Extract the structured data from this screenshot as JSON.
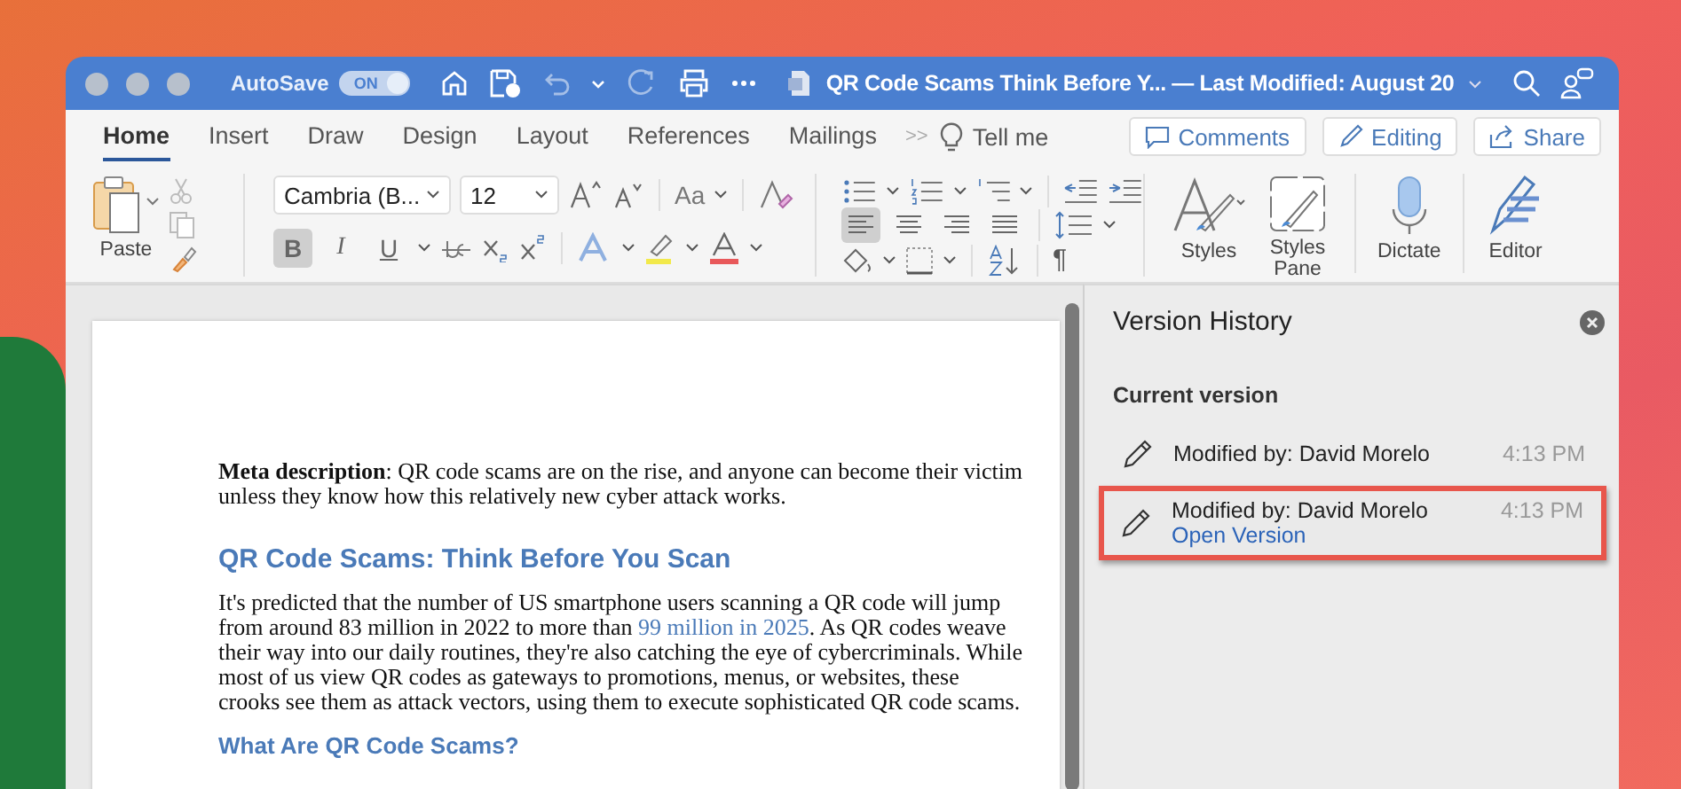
{
  "window": {
    "title": "QR Code Scams Think Before Y... — Last Modified: August 20",
    "autosave": {
      "label": "AutoSave",
      "on": true,
      "toggle_text": "ON"
    }
  },
  "ribbon_tabs": [
    {
      "label": "Home",
      "selected": true
    },
    {
      "label": "Insert",
      "selected": false
    },
    {
      "label": "Draw",
      "selected": false
    },
    {
      "label": "Design",
      "selected": false
    },
    {
      "label": "Layout",
      "selected": false
    },
    {
      "label": "References",
      "selected": false
    },
    {
      "label": "Mailings",
      "selected": false
    }
  ],
  "more_tabs": ">>",
  "tell_me": "Tell me",
  "actions": [
    {
      "kind": "comments",
      "label": "Comments"
    },
    {
      "kind": "editing",
      "label": "Editing"
    },
    {
      "kind": "share",
      "label": "Share"
    }
  ],
  "ribbon": {
    "paste": "Paste",
    "font": "Cambria (B...",
    "size": "12",
    "change_case": "Aa",
    "format_buttons": [
      {
        "label": "B",
        "selected": true
      },
      {
        "label": "I",
        "selected": false
      },
      {
        "label": "U",
        "selected": false
      }
    ],
    "alignments": [
      {
        "selected": true
      },
      {
        "selected": false
      },
      {
        "selected": false
      },
      {
        "selected": false
      }
    ],
    "pilcrow": "¶",
    "big_buttons": [
      {
        "kind": "styles",
        "label": "Styles"
      },
      {
        "kind": "styles_pane",
        "label": "Styles Pane"
      },
      {
        "kind": "dictate",
        "label": "Dictate"
      },
      {
        "kind": "editor",
        "label": "Editor"
      }
    ]
  },
  "document": {
    "meta": "**Meta description**: QR code scams are on the rise, and anyone can become their victim unless they know how this relatively new cyber attack works.",
    "heading": "QR Code Scams: Think Before You Scan",
    "paragraph": {
      "before": "It's predicted that the number of US smartphone users scanning a QR code will jump from around 83 million in 2022 to more than",
      "link": "99 million in 2025",
      "after": ". As QR codes weave their way into our daily routines, they're also catching the eye of cybercriminals. While most of us view QR codes as gateways to promotions, menus, or websites, these crooks see them as attack vectors, using them to execute sophisticated QR code scams."
    },
    "subheading": "What Are QR Code Scams?"
  },
  "version_history": {
    "title": "Version History",
    "section": "Current version",
    "entries": [
      {
        "author": "Modified by: David Morelo",
        "time": "4:13 PM",
        "selected": false
      },
      {
        "author": "Modified by: David Morelo",
        "time": "4:13 PM",
        "selected": true,
        "action": "Open Version"
      }
    ]
  }
}
